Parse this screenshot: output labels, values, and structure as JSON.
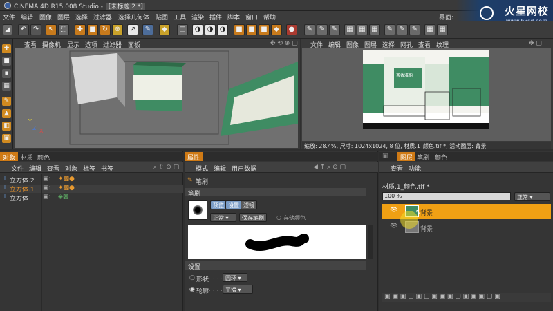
{
  "window": {
    "title": "CINEMA 4D R15.008 Studio - ",
    "doc_tab": "[未标题 2 *]",
    "interface_label": "界面:"
  },
  "watermark": {
    "brand": "火星网校",
    "url": "www.hxsd.com"
  },
  "menu": [
    "文件",
    "编辑",
    "图像",
    "图层",
    "选择",
    "过滤器",
    "选择几何体",
    "贴图",
    "工具",
    "渲染",
    "插件",
    "脚本",
    "窗口",
    "帮助"
  ],
  "viewport": {
    "menu": [
      "查看",
      "摄像机",
      "显示",
      "选项",
      "过滤器",
      "面板"
    ],
    "axis": {
      "y": "Y",
      "z": "Z",
      "x": "X"
    }
  },
  "bodypaint": {
    "menu": [
      "文件",
      "编辑",
      "图像",
      "图层",
      "选择",
      "网孔",
      "查看",
      "纹理"
    ],
    "status": "缩放: 28.4%, 尺寸: 1024x1024, 8 位, 材质.1_颜色.tif *, 活动图层: 背景",
    "texture_title": "茶香雅韵"
  },
  "objects": {
    "tabs": [
      "对象",
      "材质",
      "颜色"
    ],
    "menu": [
      "文件",
      "编辑",
      "查看",
      "对象",
      "标签",
      "书签"
    ],
    "items": [
      {
        "name": "立方体.2",
        "selected": false
      },
      {
        "name": "立方体.1",
        "selected": true
      },
      {
        "name": "立方体",
        "selected": false
      }
    ]
  },
  "attributes": {
    "tab": "属性",
    "menu": [
      "模式",
      "编辑",
      "用户数据"
    ],
    "tool_name": "笔刷",
    "section_brush": "笔刷",
    "preset_buttons": [
      "预览",
      "设置",
      "滤镜"
    ],
    "mode_value": "正常",
    "save_brush": "保存笔刷",
    "store_color": "存储颜色",
    "section_settings": "设置",
    "shape_label": "形状",
    "shape_value": "圆环",
    "contour_label": "轮廓",
    "contour_value": "平滑"
  },
  "layers": {
    "tabs": [
      "图层",
      "笔刷",
      "颜色"
    ],
    "menu": [
      "查看",
      "功能"
    ],
    "file": "材质.1_颜色.tif *",
    "opacity": "100 %",
    "blend": "正常",
    "items": [
      {
        "name": "背景",
        "active": true
      },
      {
        "name": "背景",
        "active": false
      }
    ]
  },
  "colors": {
    "accent": "#cf7a15",
    "bg": "#353535"
  }
}
